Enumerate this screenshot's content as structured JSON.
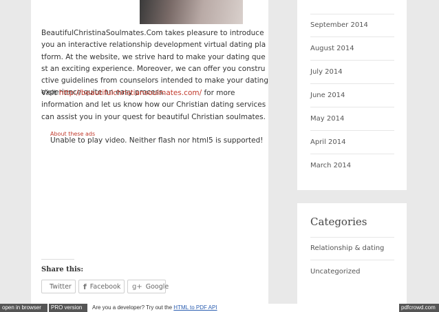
{
  "post": {
    "intro": "BeautifulChristinaSoulmates.Com takes pleasure to introduce you an interactive relationship development virtual dating platform. At the website, we strive hard to make your dating quest an exciting experience. Moreover, we can offer you constructive guidelines from counselors intended to make your dating experience quite an easy process.",
    "visit_prefix": "Visit ",
    "visit_link": "http://beautifulchristiansoulmates.com/",
    "visit_suffix": " for more information and let us know how our Christian dating services can assist you in your quest for beautiful Christian soulmates.",
    "ads_label": "About these ads",
    "video_msg": "Unable to play video. Neither flash nor html5 is supported!"
  },
  "share": {
    "title": "Share this:",
    "buttons": [
      {
        "label": "Twitter",
        "icon": "twitter-icon"
      },
      {
        "label": "Facebook",
        "icon": "facebook-icon"
      },
      {
        "label": "Google",
        "icon": "google-plus-icon"
      }
    ]
  },
  "sidebar": {
    "archives": [
      "September 2014",
      "August 2014",
      "July 2014",
      "June 2014",
      "May 2014",
      "April 2014",
      "March 2014"
    ],
    "categories_title": "Categories",
    "categories": [
      "Relationship & dating",
      "Uncategorized"
    ]
  },
  "footer": {
    "open_browser": "open in browser",
    "pro": "PRO version",
    "dev_text": "Are you a developer? Try out the ",
    "api_link": "HTML to PDF API",
    "brand": "pdfcrowd.com"
  },
  "colors": {
    "accent_link": "#c0392b",
    "footer_dark": "#555555",
    "page_bg": "#e9e9e9"
  }
}
